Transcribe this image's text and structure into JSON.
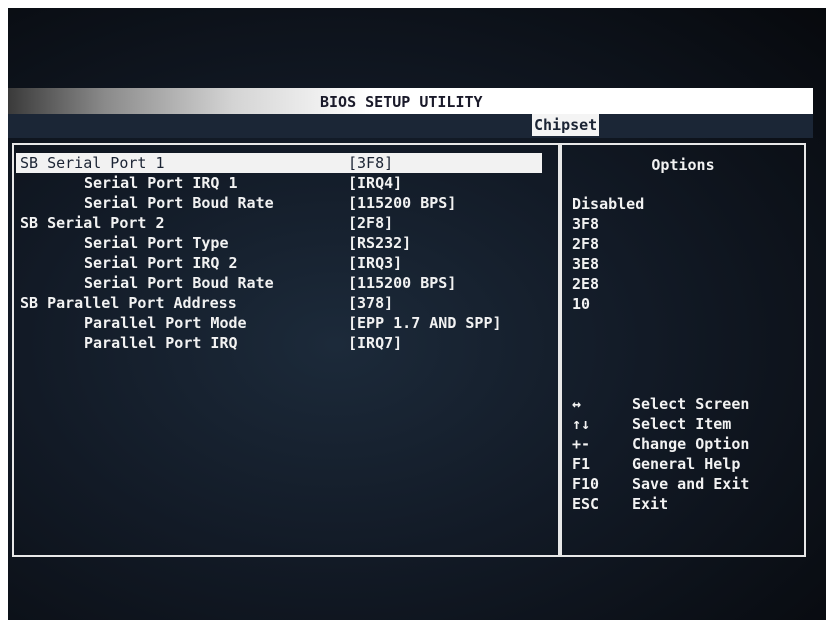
{
  "title": "BIOS SETUP UTILITY",
  "active_tab": "Chipset",
  "settings": [
    {
      "label": "SB Serial Port 1",
      "value": "[3F8]",
      "indent": false,
      "selected": true
    },
    {
      "label": "Serial Port IRQ 1",
      "value": "[IRQ4]",
      "indent": true
    },
    {
      "label": "Serial Port Boud Rate",
      "value": "[115200 BPS]",
      "indent": true
    },
    {
      "label": "SB Serial Port 2",
      "value": "[2F8]",
      "indent": false
    },
    {
      "label": "Serial Port Type",
      "value": "[RS232]",
      "indent": true
    },
    {
      "label": "Serial Port IRQ 2",
      "value": "[IRQ3]",
      "indent": true
    },
    {
      "label": "Serial Port Boud Rate",
      "value": "[115200 BPS]",
      "indent": true
    },
    {
      "label": "SB Parallel Port Address",
      "value": "[378]",
      "indent": false
    },
    {
      "label": "Parallel Port Mode",
      "value": "[EPP 1.7 AND SPP]",
      "indent": true
    },
    {
      "label": "Parallel Port IRQ",
      "value": "[IRQ7]",
      "indent": true
    }
  ],
  "options": {
    "title": "Options",
    "items": [
      "Disabled",
      "3F8",
      "2F8",
      "3E8",
      "2E8",
      "10"
    ]
  },
  "help": [
    {
      "key": "↔",
      "desc": "Select Screen"
    },
    {
      "key": "↑↓",
      "desc": "Select Item"
    },
    {
      "key": "+-",
      "desc": "Change Option"
    },
    {
      "key": "F1",
      "desc": "General Help"
    },
    {
      "key": "F10",
      "desc": "Save and Exit"
    },
    {
      "key": "ESC",
      "desc": "Exit"
    }
  ],
  "colors": {
    "background": "#121a26",
    "text": "#f2f2f2",
    "highlight_bg": "#f2f2f2",
    "highlight_text": "#1b2434"
  }
}
